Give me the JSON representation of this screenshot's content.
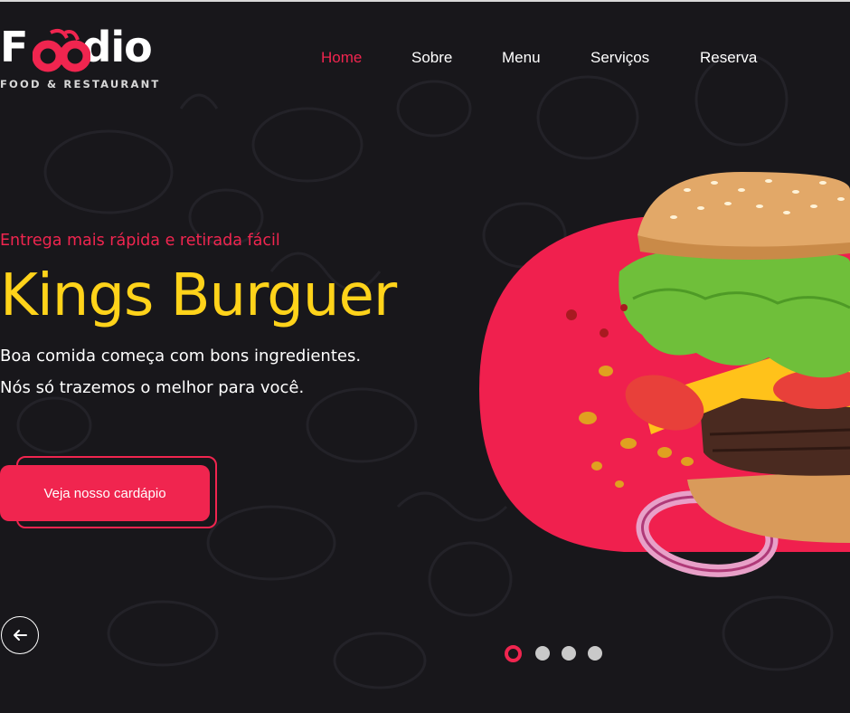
{
  "brand": {
    "logo_name": "Foodio",
    "logo_word_prefix": "F",
    "logo_word_suffix": "dio",
    "tagline": "FOOD & RESTAURANT",
    "accent_color": "#f0254f",
    "headline_color": "#ffd31a",
    "background_color": "#18171b"
  },
  "nav": {
    "items": [
      {
        "label": "Home",
        "active": true
      },
      {
        "label": "Sobre",
        "active": false
      },
      {
        "label": "Menu",
        "active": false
      },
      {
        "label": "Serviços",
        "active": false
      },
      {
        "label": "Reserva",
        "active": false
      }
    ]
  },
  "hero": {
    "eyebrow": "Entrega mais rápida e retirada fácil",
    "title": "Kings Burguer",
    "description_line1": "Boa comida começa com bons ingredientes.",
    "description_line2": "Nós só trazemos o melhor para você.",
    "cta_label": "Veja nosso cardápio",
    "image": "burger-icon"
  },
  "carousel": {
    "prev_icon": "arrow-left-icon",
    "slide_count": 4,
    "active_slide": 1
  }
}
